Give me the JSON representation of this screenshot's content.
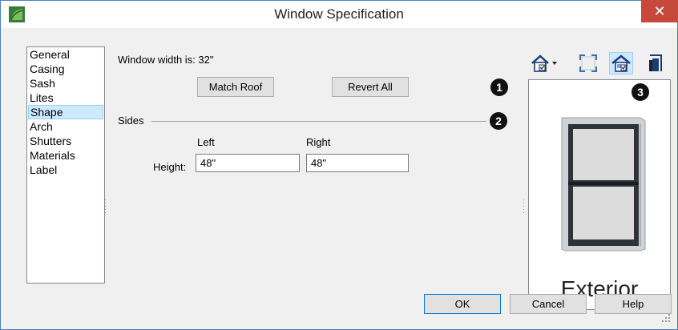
{
  "window": {
    "title": "Window Specification",
    "close": "✕"
  },
  "sidebar": {
    "items": [
      {
        "label": "General"
      },
      {
        "label": "Casing"
      },
      {
        "label": "Sash"
      },
      {
        "label": "Lites"
      },
      {
        "label": "Shape",
        "selected": true
      },
      {
        "label": "Arch"
      },
      {
        "label": "Shutters"
      },
      {
        "label": "Materials"
      },
      {
        "label": "Label"
      }
    ]
  },
  "shape": {
    "width_text": "Window width is:  32\"",
    "match_roof": "Match Roof",
    "revert_all": "Revert All",
    "sides_title": "Sides",
    "left_header": "Left",
    "right_header": "Right",
    "height_label": "Height:",
    "left_height": "48\"",
    "right_height": "48\""
  },
  "callouts": [
    "1",
    "2",
    "3"
  ],
  "preview": {
    "label": "Exterior",
    "toolbar": [
      "view-options-icon",
      "fill-window-icon",
      "exterior-view-icon",
      "interior-view-icon"
    ]
  },
  "footer": {
    "ok": "OK",
    "cancel": "Cancel",
    "help": "Help"
  },
  "colors": {
    "accent": "#0078d7",
    "selection": "#cde8ff",
    "close": "#c7483c",
    "callout": "#111111"
  }
}
